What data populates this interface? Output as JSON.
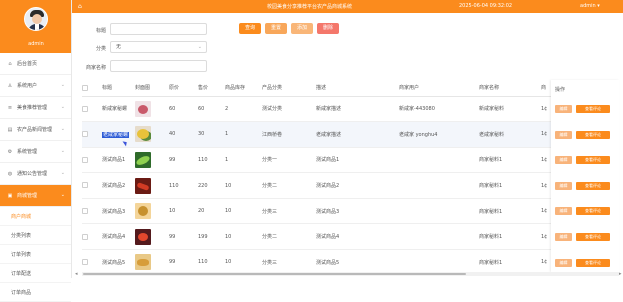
{
  "app": {
    "title": "校园美食分享推荐平台农产品商城系统",
    "datetime": "2025-06-04 09:32:02",
    "user": "admin ▾"
  },
  "profile": {
    "name": "admin"
  },
  "sidebar": {
    "items": [
      {
        "label": "后台首页",
        "icon": "home-icon",
        "glyph": "⌂",
        "has_chevron": false,
        "active": false
      },
      {
        "label": "系统用户",
        "icon": "user-icon",
        "glyph": "♙",
        "has_chevron": true,
        "active": false
      },
      {
        "label": "美食推荐管理",
        "icon": "list-icon",
        "glyph": "≡",
        "has_chevron": true,
        "active": false
      },
      {
        "label": "农产品新闻管理",
        "icon": "news-icon",
        "glyph": "▤",
        "has_chevron": true,
        "active": false
      },
      {
        "label": "系统管理",
        "icon": "gear-icon",
        "glyph": "⚙",
        "has_chevron": true,
        "active": false
      },
      {
        "label": "通知公告管理",
        "icon": "bell-icon",
        "glyph": "◍",
        "has_chevron": true,
        "active": false
      },
      {
        "label": "商城管理",
        "icon": "shop-icon",
        "glyph": "▣",
        "has_chevron": true,
        "active": true
      }
    ],
    "sub_items": [
      {
        "label": "商户商城",
        "active": true
      },
      {
        "label": "分类列表",
        "active": false
      },
      {
        "label": "订单列表",
        "active": false
      },
      {
        "label": "订单配送",
        "active": false
      },
      {
        "label": "订单商品",
        "active": false
      }
    ]
  },
  "filters": {
    "title_label": "标题",
    "title_value": "",
    "category_label": "分类",
    "category_value": "无",
    "merchant_label": "商家名称",
    "merchant_value": ""
  },
  "toolbar": {
    "query_label": "查询",
    "reset_label": "重置",
    "add_label": "添加",
    "delete_label": "删除",
    "colors": {
      "query": "#fb8b1d",
      "reset": "#f8a75a",
      "add": "#f9b678",
      "delete": "#f4776b"
    }
  },
  "table": {
    "columns": [
      "标题",
      "封面图",
      "原价",
      "售价",
      "商品库存",
      "产品分类",
      "描述",
      "商家用户",
      "商家名称",
      "商"
    ],
    "ops_header": "操作",
    "rows": [
      {
        "title": "新咸家秘螺",
        "thumb": "t0",
        "orig": "60",
        "price": "60",
        "stock": "2",
        "cat": "测试分类",
        "desc": "新咸家描述",
        "user": "新咸家-443080",
        "merchant": "新咸家秘料",
        "extra": "1¢",
        "highlight": false
      },
      {
        "title": "老咸家秘螺",
        "thumb": "t1",
        "orig": "40",
        "price": "30",
        "stock": "1",
        "cat": "江西桥卷",
        "desc": "老咸家描述",
        "user": "老咸家 yonghu4",
        "merchant": "老咸家秘料",
        "extra": "1¢",
        "highlight": true
      },
      {
        "title": "测试商品1",
        "thumb": "t2",
        "orig": "99",
        "price": "110",
        "stock": "1",
        "cat": "分类一",
        "desc": "测试商品1",
        "user": "",
        "merchant": "商家秘料1",
        "extra": "1¢",
        "highlight": false
      },
      {
        "title": "测试商品2",
        "thumb": "t3",
        "orig": "110",
        "price": "220",
        "stock": "10",
        "cat": "分类二",
        "desc": "测试商品2",
        "user": "",
        "merchant": "商家秘料1",
        "extra": "1¢",
        "highlight": false
      },
      {
        "title": "测试商品3",
        "thumb": "t4",
        "orig": "10",
        "price": "20",
        "stock": "10",
        "cat": "分类三",
        "desc": "测试商品3",
        "user": "",
        "merchant": "商家秘料1",
        "extra": "1¢",
        "highlight": false
      },
      {
        "title": "测试商品4",
        "thumb": "t5",
        "orig": "99",
        "price": "199",
        "stock": "10",
        "cat": "分类二",
        "desc": "测试商品4",
        "user": "",
        "merchant": "商家秘料1",
        "extra": "1¢",
        "highlight": false
      },
      {
        "title": "测试商品5",
        "thumb": "t6",
        "orig": "99",
        "price": "110",
        "stock": "10",
        "cat": "分类三",
        "desc": "测试商品5",
        "user": "",
        "merchant": "商家秘料1",
        "extra": "1¢",
        "highlight": false
      }
    ],
    "edit_label": "编辑",
    "review_label": "查看评论"
  },
  "scroll": {
    "left_arrow": "◂",
    "right_arrow": "▸"
  }
}
